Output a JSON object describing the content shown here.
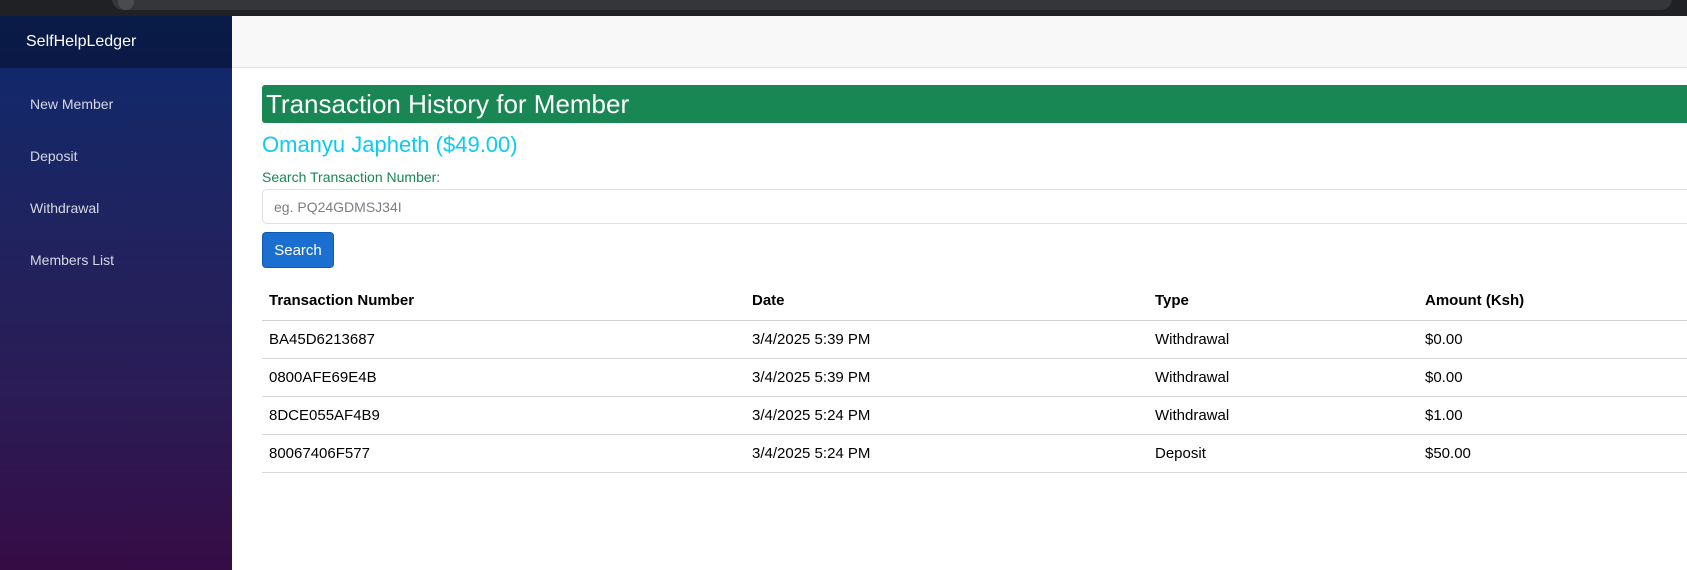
{
  "brand": "SelfHelpLedger",
  "sidebar": {
    "items": [
      {
        "label": "New Member"
      },
      {
        "label": "Deposit"
      },
      {
        "label": "Withdrawal"
      },
      {
        "label": "Members List"
      }
    ]
  },
  "page": {
    "title": "Transaction History for Member",
    "member": "Omanyu Japheth ($49.00)"
  },
  "search": {
    "label": "Search Transaction Number:",
    "placeholder": "eg. PQ24GDMSJ34I",
    "value": "",
    "button": "Search"
  },
  "table": {
    "headers": [
      "Transaction Number",
      "Date",
      "Type",
      "Amount (Ksh)"
    ],
    "rows": [
      [
        "BA45D6213687",
        "3/4/2025 5:39 PM",
        "Withdrawal",
        "$0.00"
      ],
      [
        "0800AFE69E4B",
        "3/4/2025 5:39 PM",
        "Withdrawal",
        "$0.00"
      ],
      [
        "8DCE055AF4B9",
        "3/4/2025 5:24 PM",
        "Withdrawal",
        "$1.00"
      ],
      [
        "80067406F577",
        "3/4/2025 5:24 PM",
        "Deposit",
        "$50.00"
      ]
    ]
  },
  "colors": {
    "title_bg": "#198754",
    "member_name": "#0dcaf0",
    "button_bg": "#1a6fd0",
    "sidebar_top": "#0e2a6e",
    "sidebar_bottom": "#360c45"
  }
}
